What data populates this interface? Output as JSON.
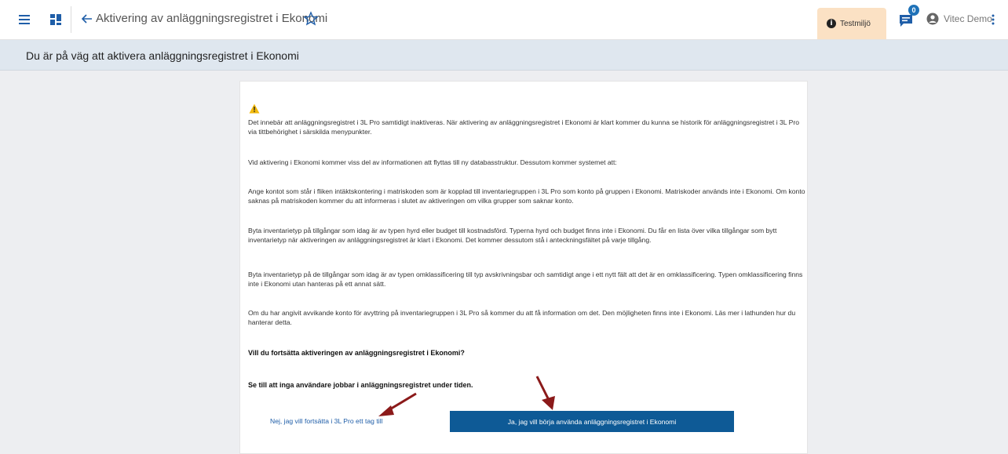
{
  "topbar": {
    "title": "Aktivering av anläggningsregistret i Ekonomi",
    "env_label": "Testmiljö",
    "notification_count": "0",
    "user_name": "Vitec Demo"
  },
  "subheader": {
    "text": "Du är på väg att aktivera anläggningsregistret i Ekonomi"
  },
  "content": {
    "p1": "Det innebär att anläggningsregistret i 3L Pro samtidigt inaktiveras. När aktivering av anläggningsregistret i Ekonomi är klart kommer du kunna se historik för anläggningsregistret i 3L Pro via tittbehörighet i särskilda menypunkter.",
    "p2": "Vid aktivering i Ekonomi kommer viss del av informationen att flyttas till ny databasstruktur. Dessutom kommer systemet att:",
    "p3": "Ange kontot som står i fliken intäktskontering i matriskoden som är kopplad till inventariegruppen i 3L Pro som konto på gruppen i Ekonomi. Matriskoder används inte i Ekonomi. Om konto saknas på matriskoden kommer du att informeras i slutet av aktiveringen om vilka grupper som saknar konto.",
    "p4": "Byta inventarietyp på tillgångar som idag är av typen hyrd eller budget till kostnadsförd. Typerna hyrd och budget finns inte i Ekonomi. Du får en lista över vilka tillgångar som bytt inventarietyp när aktiveringen av anläggningsregistret är klart i Ekonomi. Det kommer dessutom stå i anteckningsfältet på varje tillgång.",
    "p5": "Byta inventarietyp på de tillgångar som idag är av typen omklassificering till typ avskrivningsbar och samtidigt ange i ett nytt fält att det är en omklassificering. Typen omklassificering finns inte i Ekonomi utan hanteras på ett annat sätt.",
    "p6": "Om du har angivit avvikande konto för avyttring på inventariegruppen i 3L Pro så kommer du att få information om det. Den möjligheten finns inte i Ekonomi. Läs mer i lathunden hur du hanterar detta.",
    "question": "Vill du fortsätta aktiveringen av anläggningsregistret i Ekonomi?",
    "notice": "Se till att inga användare jobbar i anläggningsregistret under tiden.",
    "no_label": "Nej, jag vill fortsätta i 3L Pro ett tag till",
    "yes_label": "Ja, jag vill börja använda anläggningsregistret i Ekonomi"
  },
  "colors": {
    "primary": "#0e5a96",
    "link": "#1f5ea8",
    "env_badge": "#fbe1c4",
    "annotation_arrow": "#8b1a1a",
    "warning": "#f2b90c"
  },
  "icons": [
    "menu-icon",
    "apps-icon",
    "back-arrow-icon",
    "star-icon",
    "info-icon",
    "chat-icon",
    "user-icon",
    "more-vert-icon",
    "warning-icon"
  ]
}
